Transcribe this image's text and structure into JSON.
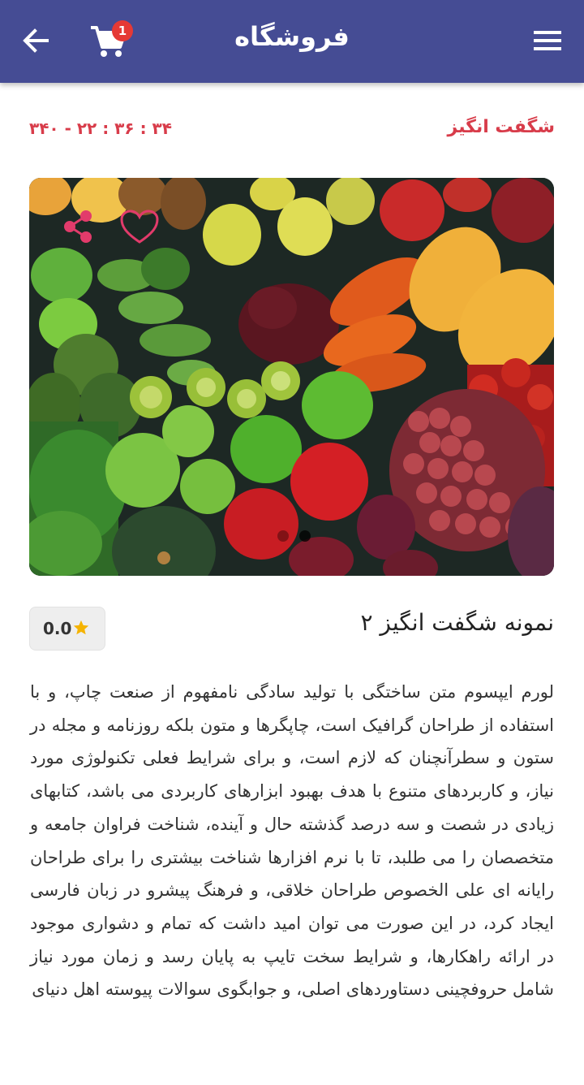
{
  "header": {
    "title": "فروشگاه",
    "cart_count": "1",
    "back_icon": "arrow-left-icon",
    "cart_icon": "shopping-cart-icon",
    "menu_icon": "hamburger-menu-icon",
    "bar_color": "#454c94",
    "badge_color": "#e53935"
  },
  "offer": {
    "label": "شگفت انگیز",
    "countdown": "۳۴۰ - ۲۲ : ۳۶ : ۳۴",
    "color": "#d83c4a"
  },
  "gallery": {
    "image": "fresh fruits and vegetables photo",
    "share_icon": "share-icon",
    "favorite_icon": "heart-outline-icon",
    "slide_count": 2,
    "active_slide": 2
  },
  "product": {
    "name": "نمونه شگفت انگیز ۲",
    "rating": "0.0",
    "rating_icon": "star-icon",
    "description": "لورم ایپسوم متن ساختگی با تولید سادگی نامفهوم از صنعت چاپ، و با استفاده از طراحان گرافیک است، چاپگرها و متون بلکه روزنامه و مجله در ستون و سطرآنچنان که لازم است، و برای شرایط فعلی تکنولوژی مورد نیاز، و کاربردهای متنوع با هدف بهبود ابزارهای کاربردی می باشد، کتابهای زیادی در شصت و سه درصد گذشته حال و آینده، شناخت فراوان جامعه و متخصصان را می طلبد، تا با نرم افزارها شناخت بیشتری را برای طراحان رایانه ای علی الخصوص طراحان خلاقی، و فرهنگ پیشرو در زبان فارسی ایجاد کرد، در این صورت می توان امید داشت که تمام و دشواری موجود در ارائه راهکارها، و شرایط سخت تایپ به پایان رسد و زمان مورد نیاز شامل حروفچینی دستاوردهای اصلی، و جوابگوی سوالات پیوسته اهل دنیای"
  }
}
